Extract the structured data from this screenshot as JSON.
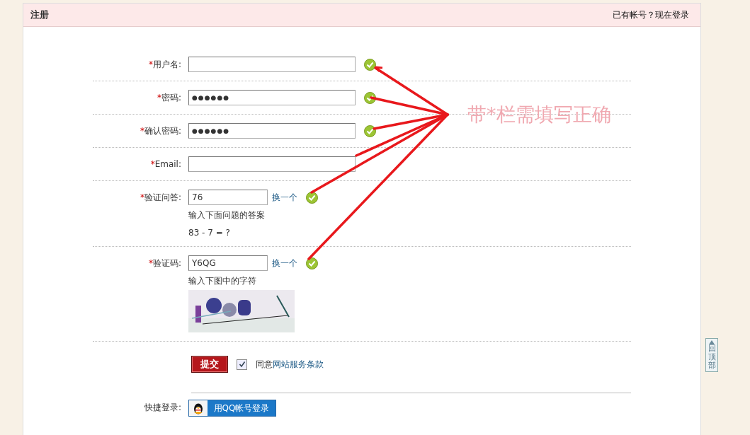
{
  "header": {
    "title": "注册",
    "login_prompt": "已有帐号？现在登录"
  },
  "fields": [
    {
      "kind": "text",
      "mark": "*",
      "label": "用户名:",
      "valid": true
    },
    {
      "kind": "password",
      "mark": "*",
      "label": "密码:",
      "value": "●●●●●●",
      "valid": true
    },
    {
      "kind": "password",
      "mark": "*",
      "label": "确认密码:",
      "value": "●●●●●●",
      "valid": true
    },
    {
      "kind": "email",
      "mark": "*",
      "label": "Email:",
      "valid": false
    },
    {
      "kind": "question",
      "mark": "*",
      "label": "验证问答:",
      "value": "76",
      "refresh": "换一个",
      "valid": true,
      "hint": "输入下面问题的答案",
      "question": "83 - 7 = ?"
    },
    {
      "kind": "captcha",
      "mark": "*",
      "label": "验证码:",
      "value": "Y6QG",
      "refresh": "换一个",
      "valid": true,
      "hint": "输入下图中的字符"
    }
  ],
  "submit": {
    "label": "提交"
  },
  "agree": {
    "checked": true,
    "text": "同意",
    "link": "网站服务条款"
  },
  "quick_login": {
    "label": "快捷登录:",
    "button": "用QQ帐号登录"
  },
  "annotation": {
    "text": "带*栏需填写正确"
  },
  "back_to_top": {
    "text": "回顶部"
  }
}
